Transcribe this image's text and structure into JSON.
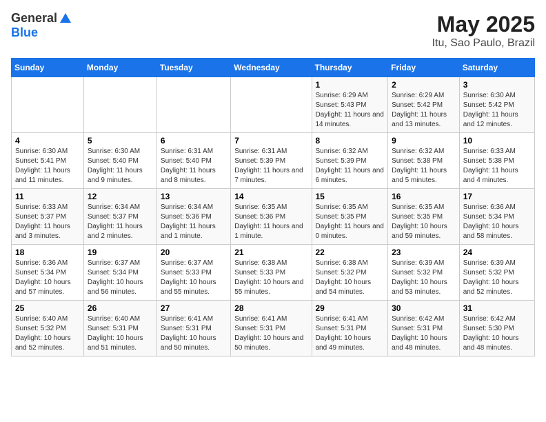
{
  "header": {
    "logo_general": "General",
    "logo_blue": "Blue",
    "title": "May 2025",
    "subtitle": "Itu, Sao Paulo, Brazil"
  },
  "days_of_week": [
    "Sunday",
    "Monday",
    "Tuesday",
    "Wednesday",
    "Thursday",
    "Friday",
    "Saturday"
  ],
  "weeks": [
    [
      {
        "day": "",
        "info": ""
      },
      {
        "day": "",
        "info": ""
      },
      {
        "day": "",
        "info": ""
      },
      {
        "day": "",
        "info": ""
      },
      {
        "day": "1",
        "info": "Sunrise: 6:29 AM\nSunset: 5:43 PM\nDaylight: 11 hours and 14 minutes."
      },
      {
        "day": "2",
        "info": "Sunrise: 6:29 AM\nSunset: 5:42 PM\nDaylight: 11 hours and 13 minutes."
      },
      {
        "day": "3",
        "info": "Sunrise: 6:30 AM\nSunset: 5:42 PM\nDaylight: 11 hours and 12 minutes."
      }
    ],
    [
      {
        "day": "4",
        "info": "Sunrise: 6:30 AM\nSunset: 5:41 PM\nDaylight: 11 hours and 11 minutes."
      },
      {
        "day": "5",
        "info": "Sunrise: 6:30 AM\nSunset: 5:40 PM\nDaylight: 11 hours and 9 minutes."
      },
      {
        "day": "6",
        "info": "Sunrise: 6:31 AM\nSunset: 5:40 PM\nDaylight: 11 hours and 8 minutes."
      },
      {
        "day": "7",
        "info": "Sunrise: 6:31 AM\nSunset: 5:39 PM\nDaylight: 11 hours and 7 minutes."
      },
      {
        "day": "8",
        "info": "Sunrise: 6:32 AM\nSunset: 5:39 PM\nDaylight: 11 hours and 6 minutes."
      },
      {
        "day": "9",
        "info": "Sunrise: 6:32 AM\nSunset: 5:38 PM\nDaylight: 11 hours and 5 minutes."
      },
      {
        "day": "10",
        "info": "Sunrise: 6:33 AM\nSunset: 5:38 PM\nDaylight: 11 hours and 4 minutes."
      }
    ],
    [
      {
        "day": "11",
        "info": "Sunrise: 6:33 AM\nSunset: 5:37 PM\nDaylight: 11 hours and 3 minutes."
      },
      {
        "day": "12",
        "info": "Sunrise: 6:34 AM\nSunset: 5:37 PM\nDaylight: 11 hours and 2 minutes."
      },
      {
        "day": "13",
        "info": "Sunrise: 6:34 AM\nSunset: 5:36 PM\nDaylight: 11 hours and 1 minute."
      },
      {
        "day": "14",
        "info": "Sunrise: 6:35 AM\nSunset: 5:36 PM\nDaylight: 11 hours and 1 minute."
      },
      {
        "day": "15",
        "info": "Sunrise: 6:35 AM\nSunset: 5:35 PM\nDaylight: 11 hours and 0 minutes."
      },
      {
        "day": "16",
        "info": "Sunrise: 6:35 AM\nSunset: 5:35 PM\nDaylight: 10 hours and 59 minutes."
      },
      {
        "day": "17",
        "info": "Sunrise: 6:36 AM\nSunset: 5:34 PM\nDaylight: 10 hours and 58 minutes."
      }
    ],
    [
      {
        "day": "18",
        "info": "Sunrise: 6:36 AM\nSunset: 5:34 PM\nDaylight: 10 hours and 57 minutes."
      },
      {
        "day": "19",
        "info": "Sunrise: 6:37 AM\nSunset: 5:34 PM\nDaylight: 10 hours and 56 minutes."
      },
      {
        "day": "20",
        "info": "Sunrise: 6:37 AM\nSunset: 5:33 PM\nDaylight: 10 hours and 55 minutes."
      },
      {
        "day": "21",
        "info": "Sunrise: 6:38 AM\nSunset: 5:33 PM\nDaylight: 10 hours and 55 minutes."
      },
      {
        "day": "22",
        "info": "Sunrise: 6:38 AM\nSunset: 5:32 PM\nDaylight: 10 hours and 54 minutes."
      },
      {
        "day": "23",
        "info": "Sunrise: 6:39 AM\nSunset: 5:32 PM\nDaylight: 10 hours and 53 minutes."
      },
      {
        "day": "24",
        "info": "Sunrise: 6:39 AM\nSunset: 5:32 PM\nDaylight: 10 hours and 52 minutes."
      }
    ],
    [
      {
        "day": "25",
        "info": "Sunrise: 6:40 AM\nSunset: 5:32 PM\nDaylight: 10 hours and 52 minutes."
      },
      {
        "day": "26",
        "info": "Sunrise: 6:40 AM\nSunset: 5:31 PM\nDaylight: 10 hours and 51 minutes."
      },
      {
        "day": "27",
        "info": "Sunrise: 6:41 AM\nSunset: 5:31 PM\nDaylight: 10 hours and 50 minutes."
      },
      {
        "day": "28",
        "info": "Sunrise: 6:41 AM\nSunset: 5:31 PM\nDaylight: 10 hours and 50 minutes."
      },
      {
        "day": "29",
        "info": "Sunrise: 6:41 AM\nSunset: 5:31 PM\nDaylight: 10 hours and 49 minutes."
      },
      {
        "day": "30",
        "info": "Sunrise: 6:42 AM\nSunset: 5:31 PM\nDaylight: 10 hours and 48 minutes."
      },
      {
        "day": "31",
        "info": "Sunrise: 6:42 AM\nSunset: 5:30 PM\nDaylight: 10 hours and 48 minutes."
      }
    ]
  ]
}
